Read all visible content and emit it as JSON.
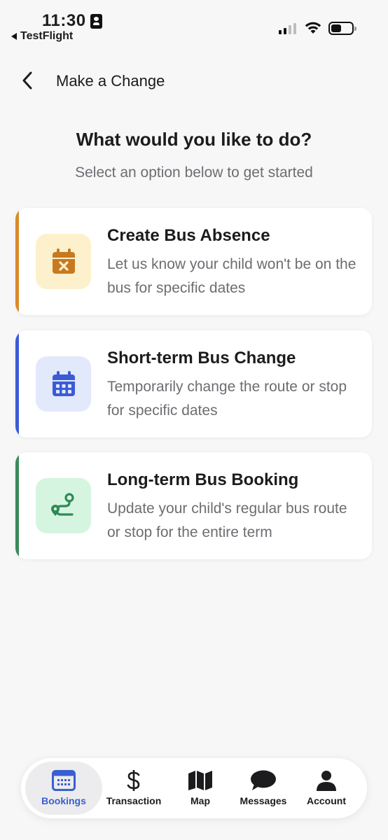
{
  "status_bar": {
    "time": "11:30",
    "back_app": "TestFlight"
  },
  "header": {
    "title": "Make a Change"
  },
  "main": {
    "heading": "What would you like to do?",
    "subheading": "Select an option below to get started",
    "options": [
      {
        "title": "Create Bus Absence",
        "description": "Let us know your child won't be on the bus for specific dates",
        "icon": "calendar-x-icon",
        "accent_color": "#d98a2b",
        "icon_bg": "#fdf0cc",
        "icon_color": "#c8791f"
      },
      {
        "title": "Short-term Bus Change",
        "description": "Temporarily change the route or stop for specific dates",
        "icon": "calendar-icon",
        "accent_color": "#3b5bd6",
        "icon_bg": "#e1e9fb",
        "icon_color": "#3b5bd6"
      },
      {
        "title": "Long-term Bus Booking",
        "description": "Update your child's regular bus route or stop for the entire term",
        "icon": "route-icon",
        "accent_color": "#3a8a5c",
        "icon_bg": "#d6f5e1",
        "icon_color": "#2f8a55"
      }
    ]
  },
  "tab_bar": {
    "items": [
      {
        "label": "Bookings",
        "icon": "calendar-grid-icon",
        "active": true
      },
      {
        "label": "Transaction",
        "icon": "dollar-icon",
        "active": false
      },
      {
        "label": "Map",
        "icon": "map-icon",
        "active": false
      },
      {
        "label": "Messages",
        "icon": "chat-bubble-icon",
        "active": false
      },
      {
        "label": "Account",
        "icon": "person-icon",
        "active": false
      }
    ],
    "active_color": "#3a5fd0"
  }
}
